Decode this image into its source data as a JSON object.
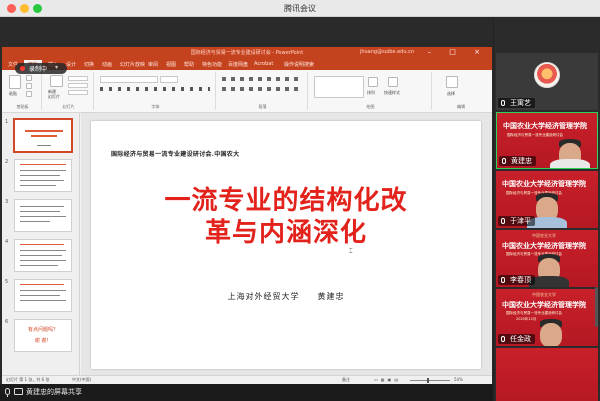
{
  "app": {
    "title": "腾讯会议"
  },
  "recording": {
    "label": "录制中"
  },
  "share": {
    "label": "黄建忠的屏幕共享"
  },
  "ppt": {
    "window_title": "国际经济与贸易一流专业建设研讨会 - PowerPoint",
    "user": "jhuang@suibe.edu.cn",
    "window_buttons": "– □ ×",
    "tabs": [
      "文件",
      "开始",
      "插入",
      "设计",
      "切换",
      "动画",
      "幻灯片放映",
      "审阅",
      "视图",
      "帮助",
      "特色功能",
      "百度网盘",
      "Acrobat",
      "操作说明搜索"
    ],
    "active_tab_index": 1,
    "ribbon_groups": [
      "剪贴板",
      "幻灯片",
      "字体",
      "段落",
      "绘图",
      "编辑"
    ],
    "ribbon_buttons": {
      "paste": "粘贴",
      "new_slide": "新建\n幻灯片",
      "arrange": "排列",
      "quick_styles": "快速样式",
      "select": "选择"
    },
    "status": {
      "slide_info": "幻灯片 第 1 张，共 6 张",
      "language": "中文(中国)",
      "notes": "备注",
      "zoom": "54%"
    },
    "slide_count": 6,
    "slide": {
      "subtitle": "国际经济与贸易一流专业建设研讨会.中国农大",
      "title_line1": "一流专业的结构化改",
      "title_line2": "革与内涵深化",
      "author": "上海对外经贸大学　　黄建忠"
    },
    "thumb_last_lines": [
      "有点问题吗？",
      "谢 谢！"
    ]
  },
  "participants": [
    {
      "name": "王寓艺",
      "type": "avatar"
    },
    {
      "name": "黄建忠",
      "type": "banner",
      "banner": "中国农业大学经济管理学院"
    },
    {
      "name": "于津平",
      "type": "banner",
      "banner": "中国农业大学经济管理学院"
    },
    {
      "name": "李春顶",
      "type": "banner",
      "banner": "中国农业大学经济管理学院"
    },
    {
      "name": "任金政",
      "type": "banner",
      "banner": "中国农业大学经济管理学院"
    }
  ],
  "banner_sub1": "国际经济与贸易一流专业建设研讨会",
  "banner_sub2": "2020年12月",
  "colors": {
    "ppt_accent": "#c5421e",
    "slide_title": "#e2221b",
    "banner_red": "#c8202a",
    "active_speaker": "#2fd25a"
  }
}
